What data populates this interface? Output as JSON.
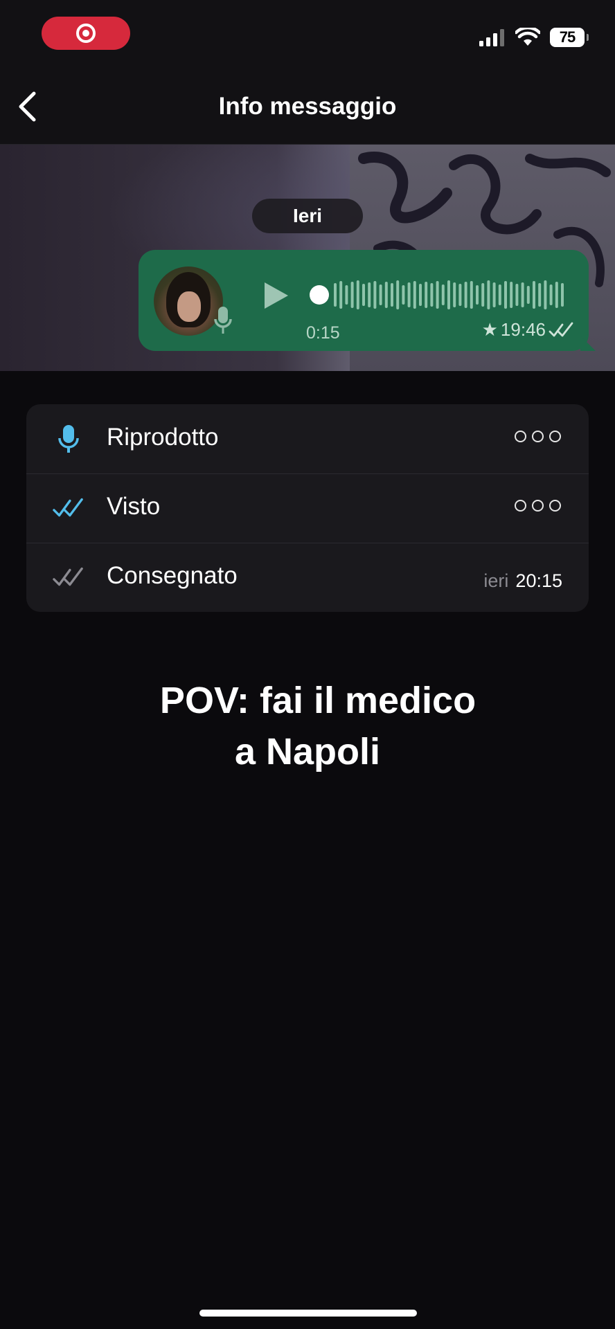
{
  "status_bar": {
    "recording_indicator": "screen-recording",
    "battery": "75"
  },
  "nav": {
    "title": "Info messaggio"
  },
  "chat": {
    "date_chip": "Ieri",
    "voice_message": {
      "duration": "0:15",
      "time": "19:46",
      "starred": true,
      "read_ticks": "double-check"
    }
  },
  "info_rows": [
    {
      "label": "Riprodotto",
      "icon": "microphone-icon",
      "value": "dots"
    },
    {
      "label": "Visto",
      "icon": "double-check-blue-icon",
      "value": "dots"
    },
    {
      "label": "Consegnato",
      "icon": "double-check-gray-icon",
      "day": "ieri",
      "time": "20:15"
    }
  ],
  "caption": {
    "line1": "POV: fai il medico",
    "line2": "a Napoli"
  },
  "colors": {
    "bubble": "#1e6b4a",
    "recording": "#d6293c",
    "read_blue": "#53bdeb",
    "card": "#1a191d"
  }
}
